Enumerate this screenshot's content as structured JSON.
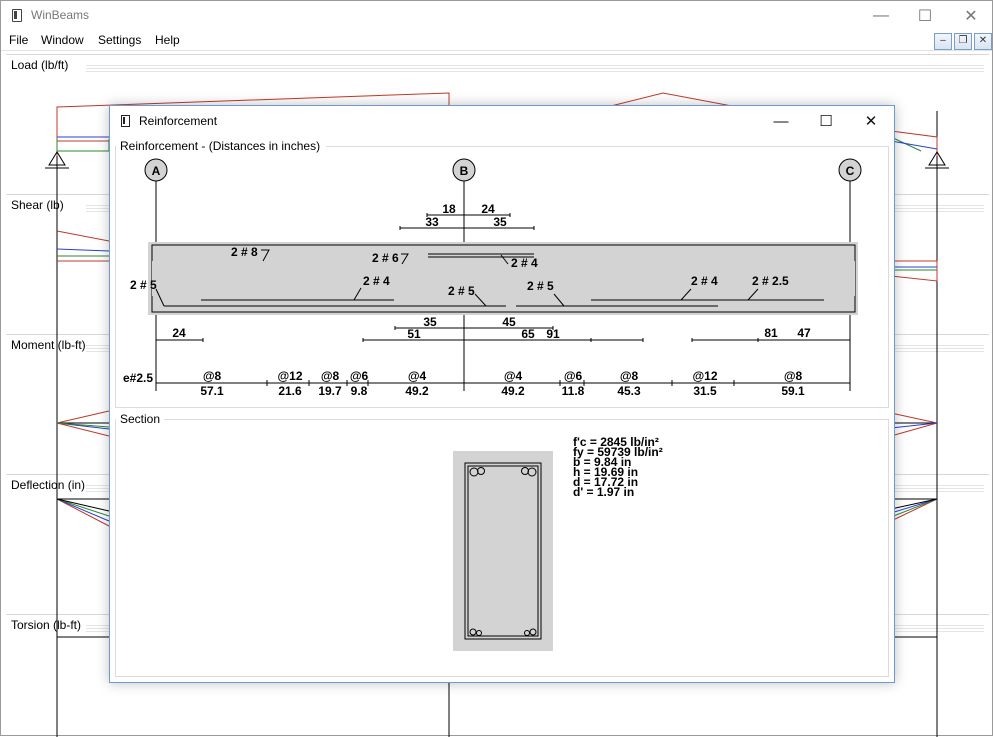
{
  "app": {
    "title": "WinBeams",
    "controls": {
      "minimize": "—",
      "maximize": "☐",
      "close": "✕"
    }
  },
  "menu": [
    "File",
    "Window",
    "Settings",
    "Help"
  ],
  "mdi_controls": {
    "minimize": "–",
    "restore": "❐",
    "close": "✕"
  },
  "panels": [
    {
      "title": "Load (lb/ft)"
    },
    {
      "title": "Shear (lb)"
    },
    {
      "title": "Moment (lb-ft)"
    },
    {
      "title": "Deflection (in)"
    },
    {
      "title": "Torsion (lb-ft)"
    }
  ],
  "dialog": {
    "title": "Reinforcement",
    "controls": {
      "minimize": "—",
      "maximize": "☐",
      "close": "✕"
    },
    "reinforcement_group": "Reinforcement - (Distances in inches)",
    "section_group": "Section",
    "supports": [
      "A",
      "B",
      "C"
    ],
    "top_dims": {
      "left_a": "18",
      "right_a": "24",
      "left_b": "33",
      "right_b": "35"
    },
    "bar_labels": {
      "top_left": "2 # 8",
      "top_mid": "2 # 6",
      "top_mid2": "2 # 4",
      "end_left": "2 # 5",
      "bot_a": "2 # 4",
      "bot_b": "2 # 5",
      "bot_c": "2 # 5",
      "bot_d": "2 # 4",
      "bot_e": "2 # 2.5"
    },
    "bottom_dims": {
      "left_24": "24",
      "mid_35": "35",
      "mid_45": "45",
      "mid_51": "51",
      "mid_65": "65",
      "mid_91": "91",
      "right_81": "81",
      "right_47": "47"
    },
    "stirrups": {
      "end_label": "e#2.5",
      "spacings": [
        "@8",
        "@12",
        "@8",
        "@6",
        "@4",
        "@4",
        "@6",
        "@8",
        "@12",
        "@8"
      ],
      "lengths": [
        "57.1",
        "21.6",
        "19.7",
        "9.8",
        "49.2",
        "49.2",
        "11.8",
        "45.3",
        "31.5",
        "59.1"
      ]
    },
    "section": {
      "fc": "f'c = 2845 lb/in²",
      "fy": "fy = 59739 lb/in²",
      "b": "b = 9.84 in",
      "h": "h = 19.69 in",
      "d": "d = 17.72 in",
      "dprime": "d' = 1.97 in"
    }
  },
  "colors": {
    "beam_fill": "#d3d3d3",
    "dialog_border": "#6c9ad0",
    "diagram_red": "#c0392b",
    "diagram_blue": "#2a3fd8",
    "diagram_green": "#2a8a2a"
  }
}
